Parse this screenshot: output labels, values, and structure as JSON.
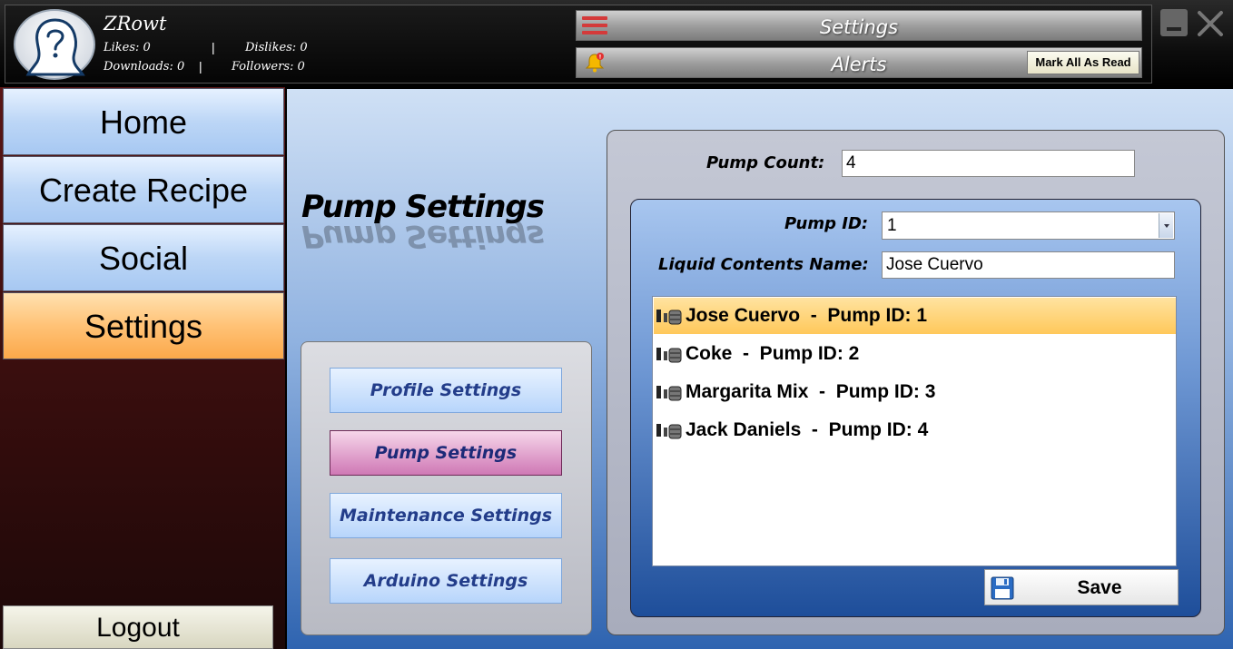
{
  "user": {
    "name": "ZRowt",
    "likes_label": "Likes: 0",
    "dislikes_label": "Dislikes: 0",
    "downloads_label": "Downloads: 0",
    "followers_label": "Followers: 0",
    "separator": "|"
  },
  "topbar": {
    "settings_label": "Settings",
    "alerts_label": "Alerts",
    "mark_all_read": "Mark All As Read",
    "alert_count": "!"
  },
  "nav": {
    "items": [
      "Home",
      "Create Recipe",
      "Social",
      "Settings"
    ],
    "active": "Settings",
    "logout": "Logout"
  },
  "page": {
    "title": "Pump Settings"
  },
  "subnav": {
    "items": [
      "Profile Settings",
      "Pump Settings",
      "Maintenance Settings",
      "Arduino Settings"
    ],
    "active": "Pump Settings"
  },
  "pump_form": {
    "pump_count_label": "Pump Count:",
    "pump_count_value": "4",
    "pump_id_label": "Pump ID:",
    "pump_id_value": "1",
    "liquid_label": "Liquid Contents Name:",
    "liquid_value": "Jose Cuervo",
    "list": [
      "Jose Cuervo  -  Pump ID: 1",
      "Coke  -  Pump ID: 2",
      "Margarita Mix  -  Pump ID: 3",
      "Jack Daniels  -  Pump ID: 4"
    ],
    "selected_index": 0,
    "save_label": "Save"
  },
  "icons": {
    "menu": "hamburger-icon",
    "alerts": "bell-icon",
    "avatar": "person-silhouette-icon",
    "pump": "pump-icon",
    "save": "floppy-disk-icon",
    "minimize": "minimize-icon",
    "close": "close-icon"
  },
  "colors": {
    "nav_active": "#ffc276",
    "nav_default": "#bcd6f6",
    "subnav_active": "#cf78b5",
    "list_selected": "#ffc85a",
    "hamburger": "#d43a3a"
  }
}
